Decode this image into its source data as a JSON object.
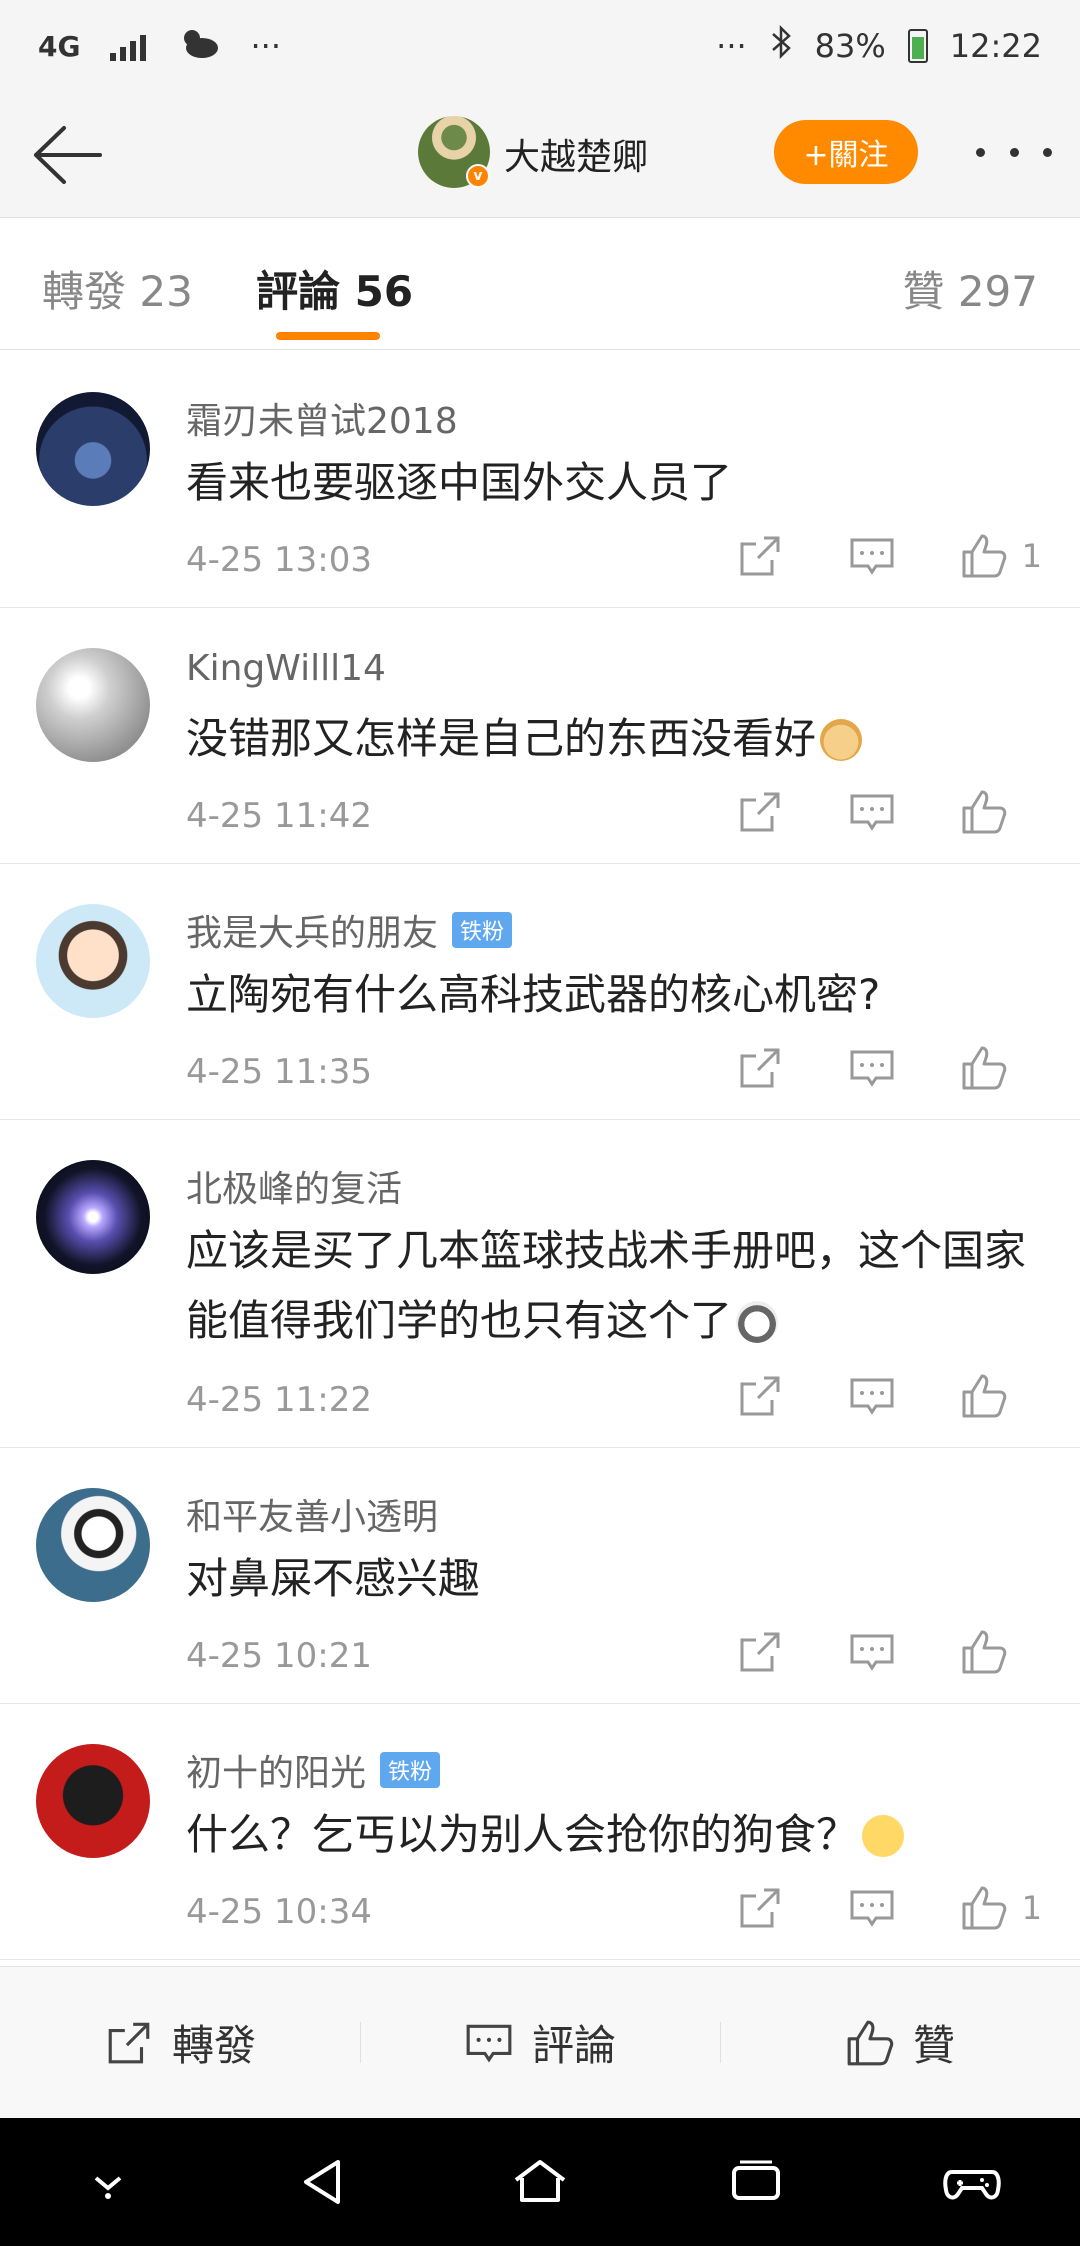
{
  "status_bar": {
    "network": "4G",
    "dots_left": "···",
    "dots_right": "···",
    "battery": "83%",
    "time": "12:22"
  },
  "header": {
    "username": "大越楚卿",
    "follow_label": "+關注"
  },
  "tabs": {
    "repost": "轉發 23",
    "comments": "評論 56",
    "likes": "贊 297"
  },
  "comments": [
    {
      "user": "霜刃未曾试2018",
      "badge": "",
      "text": "看来也要驱逐中国外交人员了",
      "emoji": "",
      "time": "4-25 13:03",
      "likes": "1"
    },
    {
      "user": "KingWilll14",
      "badge": "",
      "text": "没错那又怎样是自己的东西没看好",
      "emoji": "doge",
      "time": "4-25 11:42",
      "likes": ""
    },
    {
      "user": "我是大兵的朋友",
      "badge": "铁粉",
      "text": "立陶宛有什么高科技武器的核心机密?",
      "emoji": "",
      "time": "4-25 11:35",
      "likes": ""
    },
    {
      "user": "北极峰的复活",
      "badge": "",
      "text": "应该是买了几本篮球技战术手册吧，这个国家能值得我们学的也只有这个了",
      "emoji": "husky",
      "time": "4-25 11:22",
      "likes": ""
    },
    {
      "user": "和平友善小透明",
      "badge": "",
      "text": "对鼻屎不感兴趣",
      "emoji": "",
      "time": "4-25 10:21",
      "likes": ""
    },
    {
      "user": "初十的阳光",
      "badge": "铁粉",
      "text": "什么？乞丐以为别人会抢你的狗食？",
      "emoji": "sly",
      "time": "4-25 10:34",
      "likes": "1"
    }
  ],
  "bottom_bar": {
    "repost": "轉發",
    "comment": "評論",
    "like": "贊"
  }
}
